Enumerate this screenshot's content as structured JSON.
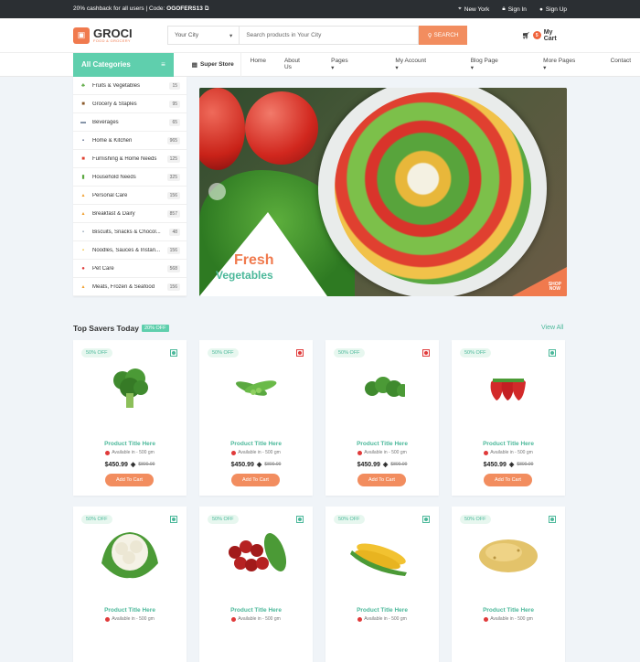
{
  "topbar": {
    "promo": "20% cashback for all users | Code:",
    "code": "OGOFERS13",
    "location": "New York",
    "signin": "Sign In",
    "signup": "Sign Up"
  },
  "header": {
    "logo_title": "GROCI",
    "logo_sub": "FOOD & GROCERY",
    "city_label": "Your City",
    "search_placeholder": "Search products in Your City",
    "search_button": "SEARCH",
    "cart_count": "5",
    "cart_label": "My Cart"
  },
  "nav": {
    "all_categories": "All Categories",
    "super_store": "Super Store",
    "items": [
      "Home",
      "About Us",
      "Pages",
      "My Account",
      "Blog Page",
      "More Pages",
      "Contact"
    ]
  },
  "categories": [
    {
      "label": "Fruits & Vegetables",
      "count": "15",
      "icon": "carrot-icon"
    },
    {
      "label": "Grocery & Staples",
      "count": "95",
      "icon": "bag-icon"
    },
    {
      "label": "Beverages",
      "count": "65",
      "icon": "bottle-icon"
    },
    {
      "label": "Home & Kitchen",
      "count": "965",
      "icon": "kitchen-icon"
    },
    {
      "label": "Furnishing & Home Needs",
      "count": "125",
      "icon": "sofa-icon"
    },
    {
      "label": "Household Needs",
      "count": "325",
      "icon": "household-icon"
    },
    {
      "label": "Personal Care",
      "count": "156",
      "icon": "soap-icon"
    },
    {
      "label": "Breakfast & Dairy",
      "count": "857",
      "icon": "milk-icon"
    },
    {
      "label": "Biscuits, Snacks & Chocol...",
      "count": "48",
      "icon": "biscuit-icon"
    },
    {
      "label": "Noodles, Sauces & Instan...",
      "count": "156",
      "icon": "noodles-icon"
    },
    {
      "label": "Pet Care",
      "count": "568",
      "icon": "pet-icon"
    },
    {
      "label": "Meats, Frozen & Seafood",
      "count": "156",
      "icon": "meat-icon"
    }
  ],
  "banner": {
    "line1": "Fresh",
    "line2": "Vegetables",
    "shop1": "SHOP",
    "shop2": "NOW"
  },
  "section": {
    "title": "Top Savers Today",
    "badge": "20% OFF",
    "view_all": "View All"
  },
  "products": [
    {
      "off": "50% OFF",
      "veg": true,
      "image": "broccoli",
      "title": "Product Title Here",
      "avail": "Available in - 500 gm",
      "price": "$450.99",
      "old": "$800.99",
      "btn": "Add To Cart"
    },
    {
      "off": "50% OFF",
      "veg": false,
      "image": "peas",
      "title": "Product Title Here",
      "avail": "Available in - 500 gm",
      "price": "$450.99",
      "old": "$800.99",
      "btn": "Add To Cart"
    },
    {
      "off": "50% OFF",
      "veg": false,
      "image": "parsley",
      "title": "Product Title Here",
      "avail": "Available in - 500 gm",
      "price": "$450.99",
      "old": "$800.99",
      "btn": "Add To Cart"
    },
    {
      "off": "50% OFF",
      "veg": true,
      "image": "strawberries",
      "title": "Product Title Here",
      "avail": "Available in - 500 gm",
      "price": "$450.99",
      "old": "$800.99",
      "btn": "Add To Cart"
    },
    {
      "off": "50% OFF",
      "veg": true,
      "image": "cauliflower",
      "title": "Product Title Here",
      "avail": "Available in - 500 gm"
    },
    {
      "off": "50% OFF",
      "veg": true,
      "image": "cherries",
      "title": "Product Title Here",
      "avail": "Available in - 500 gm"
    },
    {
      "off": "50% OFF",
      "veg": true,
      "image": "corn",
      "title": "Product Title Here",
      "avail": "Available in - 500 gm"
    },
    {
      "off": "50% OFF",
      "veg": true,
      "image": "potato",
      "title": "Product Title Here",
      "avail": "Available in - 500 gm"
    }
  ],
  "colors": {
    "accent": "#5fcfad",
    "orange": "#f28d5f",
    "dark": "#2b2f33"
  }
}
